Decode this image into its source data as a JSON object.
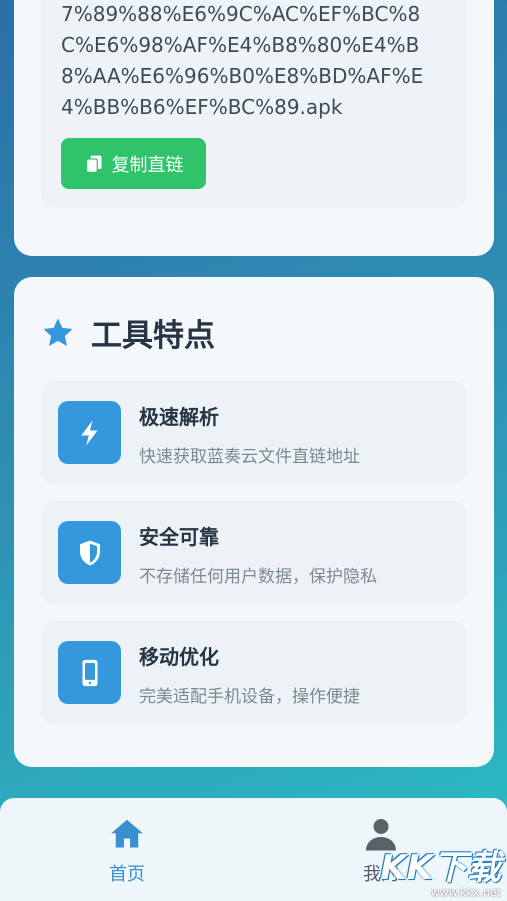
{
  "link": {
    "url_text": "7%89%88%E6%9C%AC%EF%BC%8C%E6%98%AF%E4%B8%80%E4%B8%AA%E6%96%B0%E8%BD%AF%E4%BB%B6%EF%BC%89.apk",
    "copy_label": "复制直链"
  },
  "features": {
    "title": "工具特点",
    "items": [
      {
        "title": "极速解析",
        "desc": "快速获取蓝奏云文件直链地址",
        "icon": "bolt-icon"
      },
      {
        "title": "安全可靠",
        "desc": "不存储任何用户数据，保护隐私",
        "icon": "shield-icon"
      },
      {
        "title": "移动优化",
        "desc": "完美适配手机设备，操作便捷",
        "icon": "mobile-icon"
      }
    ]
  },
  "nav": {
    "home_label": "首页",
    "mine_label": "我的"
  },
  "watermark": {
    "logo": "KK下载",
    "url": "www.kkx.net"
  },
  "colors": {
    "accent": "#3597dc",
    "copy_button": "#2fc46a",
    "nav_active": "#3a8fcf"
  }
}
